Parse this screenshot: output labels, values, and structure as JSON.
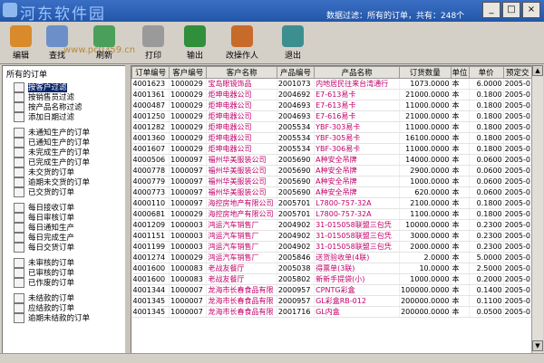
{
  "window": {
    "logo_text": "河东软件园",
    "watermark": "www.pc0359.cn",
    "filter_text": "数据过滤：所有的订单，共有：248个",
    "min": "_",
    "max": "□",
    "close": "×"
  },
  "toolbar": [
    {
      "label": "编辑",
      "icon": "edit-icon",
      "color": "#d98a2b"
    },
    {
      "label": "查找",
      "icon": "search-icon",
      "color": "#6d8fc9"
    },
    {
      "label": "刷新",
      "icon": "refresh-icon",
      "color": "#4aa05a"
    },
    {
      "label": "打印",
      "icon": "printer-icon",
      "color": "#9a9a9a"
    },
    {
      "label": "输出",
      "icon": "excel-icon",
      "color": "#2f8f3a"
    },
    {
      "label": "改操作人",
      "icon": "users-icon",
      "color": "#c86a2a"
    },
    {
      "label": "退出",
      "icon": "exit-icon",
      "color": "#3d8f8f"
    }
  ],
  "tree": {
    "root": "所有的订单",
    "groups": [
      [
        "按客户过滤",
        "按销售员过滤",
        "按产品名称过滤",
        "添加日期过滤"
      ],
      [
        "未通知生产的订单",
        "已通知生产的订单",
        "未完成生产的订单",
        "已完成生产的订单",
        "未交货的订单",
        "逾期未交货的订单",
        "已交货的订单"
      ],
      [
        "每日接收订单",
        "每日审核订单",
        "每日通知生产",
        "每日完成生产",
        "每日交货订单"
      ],
      [
        "未审核的订单",
        "已审核的订单",
        "已作废的订单"
      ],
      [
        "未结款的订单",
        "应结款的订单",
        "逾期未结款的订单"
      ]
    ]
  },
  "table": {
    "columns": [
      "订单编号",
      "客户编号",
      "客户名称",
      "产品编号",
      "产品名称",
      "订货数量",
      "单位",
      "单价",
      "预定交"
    ],
    "rows": [
      [
        "4001623",
        "1000029",
        "宝岛眼镜饰品",
        "2001073",
        "内地居民往来台湾通行",
        "1073.0000",
        "本",
        "6.0000",
        "2005-0"
      ],
      [
        "4001361",
        "1000029",
        "炬坤电器公司",
        "2004692",
        "E7-613易卡",
        "21000.0000",
        "本",
        "0.1800",
        "2005-0"
      ],
      [
        "4000487",
        "1000029",
        "炬坤电器公司",
        "2004693",
        "E7-613易卡",
        "11000.0000",
        "本",
        "0.1800",
        "2005-0"
      ],
      [
        "4001250",
        "1000029",
        "炬坤电器公司",
        "2004693",
        "E7-616易卡",
        "21000.0000",
        "本",
        "0.1800",
        "2005-0"
      ],
      [
        "4001282",
        "1000029",
        "炬坤电器公司",
        "2005534",
        "YBF-303易卡",
        "11000.0000",
        "本",
        "0.1800",
        "2005-0"
      ],
      [
        "4001360",
        "1000029",
        "炬坤电器公司",
        "2005534",
        "YBF-305易卡",
        "16100.0000",
        "本",
        "0.1800",
        "2005-0"
      ],
      [
        "4001607",
        "1000029",
        "炬坤电器公司",
        "2005534",
        "YBF-306易卡",
        "11000.0000",
        "本",
        "0.1800",
        "2005-0"
      ],
      [
        "4000506",
        "1000097",
        "福州华美服装公司",
        "2005690",
        "A种安全吊牌",
        "14000.0000",
        "本",
        "0.0600",
        "2005-0"
      ],
      [
        "4000778",
        "1000097",
        "福州华美服装公司",
        "2005690",
        "A种安全吊牌",
        "2900.0000",
        "本",
        "0.0600",
        "2005-0"
      ],
      [
        "4000779",
        "1000097",
        "福州华美服装公司",
        "2005690",
        "A种安全吊牌",
        "1000.0000",
        "本",
        "0.0600",
        "2005-0"
      ],
      [
        "4000773",
        "1000097",
        "福州华美服装公司",
        "2005690",
        "A种安全吊牌",
        "620.0000",
        "本",
        "0.0600",
        "2005-0"
      ],
      [
        "4000110",
        "1000097",
        "海控房地产有限公司",
        "2005701",
        "L7800-757-32A",
        "2100.0000",
        "本",
        "0.1800",
        "2005-0"
      ],
      [
        "4000681",
        "1000029",
        "海控房地产有限公司",
        "2005701",
        "L7800-757-32A",
        "1100.0000",
        "本",
        "0.1800",
        "2005-0"
      ],
      [
        "4001209",
        "1000003",
        "鸿运汽车销售厂",
        "2004902",
        "31-015058联盟三包凭",
        "10000.0000",
        "本",
        "0.2300",
        "2005-0"
      ],
      [
        "4001151",
        "1000003",
        "鸿运汽车销售厂",
        "2004902",
        "31-015058联盟三包凭",
        "3000.0000",
        "本",
        "0.2300",
        "2005-0"
      ],
      [
        "4001199",
        "1000003",
        "鸿运汽车销售厂",
        "2004902",
        "31-015058联盟三包凭",
        "2000.0000",
        "本",
        "0.2300",
        "2005-0"
      ],
      [
        "4001274",
        "1000029",
        "鸿运汽车销售厂",
        "2005846",
        "送货验收单(4联)",
        "2.0000",
        "本",
        "5.0000",
        "2005-0"
      ],
      [
        "4001600",
        "1000083",
        "老战友餐厅",
        "2005038",
        "得票单(3联)",
        "10.0000",
        "本",
        "2.5000",
        "2005-0"
      ],
      [
        "4001600",
        "1000083",
        "老战友餐厅",
        "2005802",
        "新新手提袋(小)",
        "1000.0000",
        "本",
        "0.2000",
        "2005-0"
      ],
      [
        "4001344",
        "1000007",
        "龙海市长春食品有限",
        "2000957",
        "CPNTG彩盒",
        "100000.0000",
        "本",
        "0.1400",
        "2005-0"
      ],
      [
        "4001345",
        "1000007",
        "龙海市长春食品有限",
        "2000957",
        "GL彩盒RB-012",
        "200000.0000",
        "本",
        "0.1100",
        "2005-0"
      ],
      [
        "4001345",
        "1000007",
        "龙海市长春食品有限",
        "2001716",
        "GL内盒",
        "200000.0000",
        "本",
        "0.0500",
        "2005-0"
      ]
    ]
  }
}
